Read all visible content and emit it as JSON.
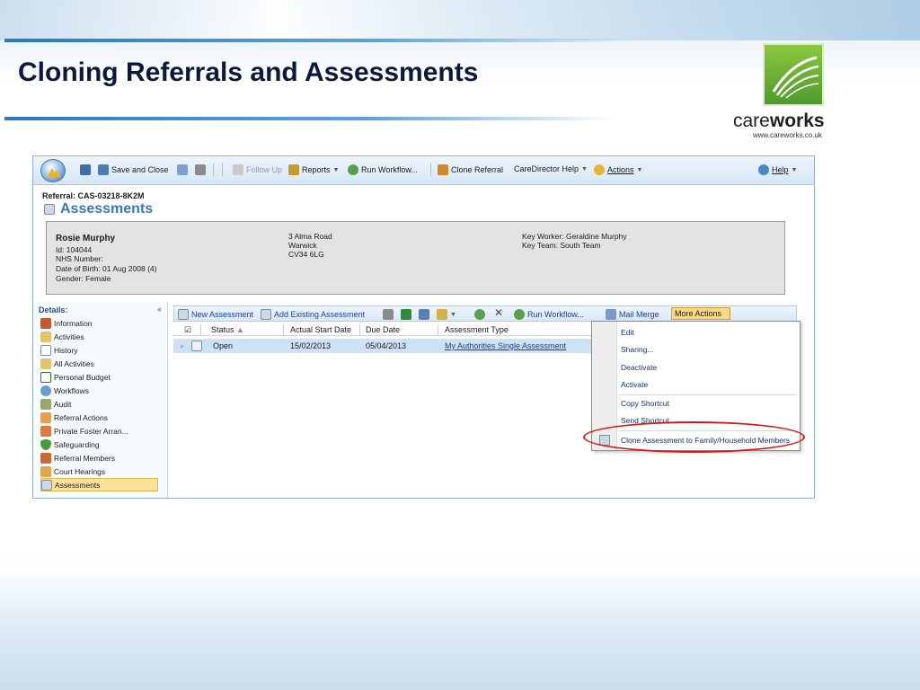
{
  "slide": {
    "title": "Cloning Referrals and Assessments",
    "logo": {
      "word_light": "care",
      "word_bold": "works",
      "url": "www.careworks.co.uk"
    }
  },
  "ribbon": {
    "save_and_close": "Save and Close",
    "follow_up": "Follow Up",
    "reports": "Reports",
    "run_workflow": "Run Workflow...",
    "clone_referral": "Clone Referral",
    "caredirector_help": "CareDirector Help",
    "actions": "Actions",
    "help": "Help"
  },
  "record": {
    "breadcrumb": "Referral: CAS-03218-8K2M",
    "heading": "Assessments",
    "name": "Rosie Murphy",
    "id": "Id: 104044",
    "nhs": "NHS Number:",
    "dob": "Date of Birth: 01 Aug 2008 (4)",
    "gender": "Gender: Female",
    "address1": "3 Alma Road",
    "address2": "Warwick",
    "address3": "CV34 6LG",
    "key_worker": "Key Worker: Geraldine Murphy",
    "key_team": "Key Team: South Team"
  },
  "details": {
    "header": "Details:",
    "items": [
      {
        "label": "Information"
      },
      {
        "label": "Activities"
      },
      {
        "label": "History"
      },
      {
        "label": "All Activities"
      },
      {
        "label": "Personal Budget"
      },
      {
        "label": "Workflows"
      },
      {
        "label": "Audit"
      },
      {
        "label": "Referral Actions"
      },
      {
        "label": "Private Foster Arran..."
      },
      {
        "label": "Safeguarding"
      },
      {
        "label": "Referral Members"
      },
      {
        "label": "Court Hearings"
      },
      {
        "label": "Assessments"
      }
    ]
  },
  "grid_toolbar": {
    "new_assessment": "New Assessment",
    "add_existing": "Add Existing Assessment",
    "run_workflow": "Run Workflow...",
    "mail_merge": "Mail Merge",
    "more_actions": "More Actions"
  },
  "grid": {
    "columns": [
      "Status",
      "Actual Start Date",
      "Due Date",
      "Assessment Type"
    ],
    "rows": [
      {
        "status": "Open",
        "start": "15/02/2013",
        "due": "05/04/2013",
        "type": "My Authorities Single Assessment"
      }
    ]
  },
  "menu": {
    "items": [
      "Edit",
      "Sharing...",
      "Deactivate",
      "Activate",
      "Copy Shortcut",
      "Send Shortcut...",
      "Clone Assessment to Family/Household Members"
    ]
  },
  "colors": {
    "accent": "#3b77b8",
    "highlight": "#fbd98b",
    "callout": "#d81818",
    "logo_green": "#6fb23a"
  }
}
